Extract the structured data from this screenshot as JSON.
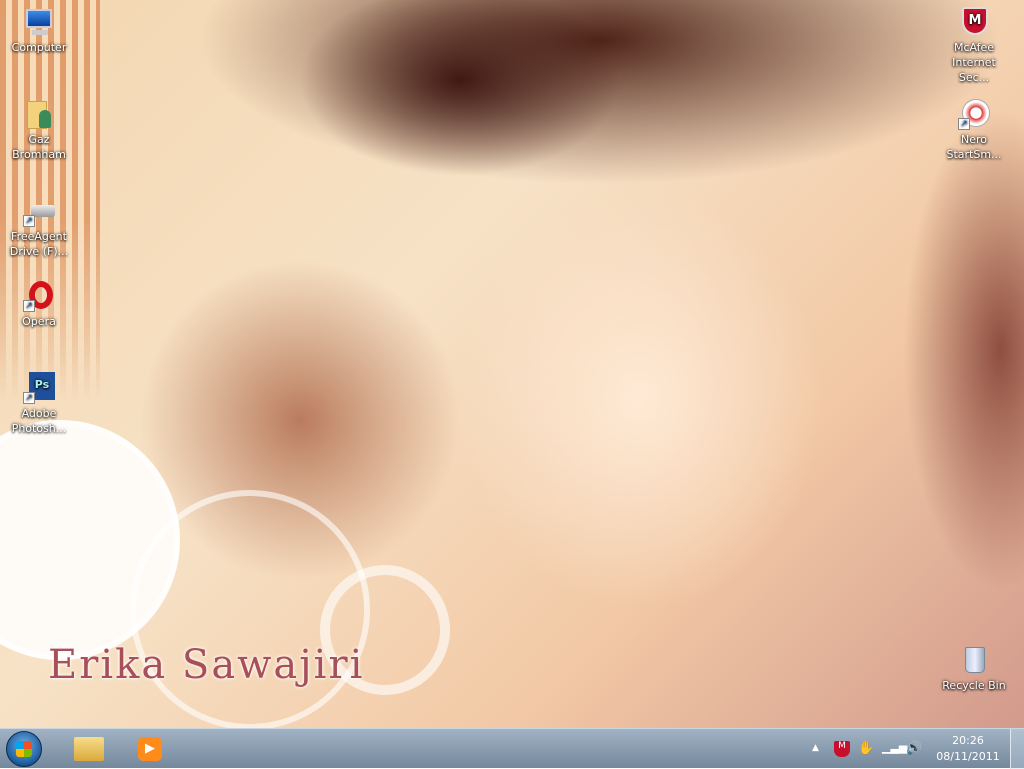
{
  "desktop": {
    "wallpaper_text": "Erika Sawajiri",
    "icons_left": [
      {
        "label": "Computer",
        "icon": "computer-icon"
      },
      {
        "label": "Gaz Bromham",
        "icon": "user-folder-icon"
      },
      {
        "label": "FreeAgent Drive (F)...",
        "icon": "drive-icon"
      },
      {
        "label": "Opera",
        "icon": "opera-icon"
      },
      {
        "label": "Adobe Photosh...",
        "icon": "photoshop-icon"
      }
    ],
    "icons_right": [
      {
        "label": "McAfee Internet Sec...",
        "icon": "mcafee-icon"
      },
      {
        "label": "Nero StartSm...",
        "icon": "nero-icon"
      },
      {
        "label": "Recycle Bin",
        "icon": "recycle-bin-icon"
      }
    ]
  },
  "taskbar": {
    "pinned": [
      "Windows Explorer",
      "Windows Media Player"
    ],
    "tray": {
      "time": "20:26",
      "date": "08/11/2011"
    }
  }
}
